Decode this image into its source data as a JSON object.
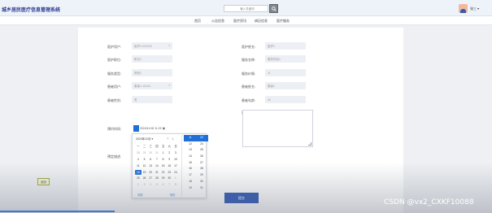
{
  "header": {
    "app_title": "城乡居民医疗信息管理系统",
    "search_placeholder": "输入关键词",
    "user_name": "张三"
  },
  "nav": {
    "items": [
      "首页",
      "公告信息",
      "医疗资讯",
      "病历信息",
      "医疗服务"
    ]
  },
  "form": {
    "labels": {
      "doctor_account": "医护用户:",
      "doctor_name": "医护姓名:",
      "doctor_title": "医护职位:",
      "service_name": "服务名称:",
      "service_type": "服务类型:",
      "service_price": "服务价格:",
      "patient_account": "患者用户:",
      "patient_name": "患者姓名:",
      "patient_gender": "患者性别:",
      "patient_age": "患者年龄:",
      "appointment_time": "预约时间:",
      "appointment_note": "预约说明:",
      "result": "预定描述:"
    },
    "values": {
      "doctor_account": "医护1-222222",
      "doctor_name": "医护1",
      "doctor_title": "职位1",
      "service_name": "服务项目1",
      "service_type": "类型1",
      "service_price": "11",
      "patient_account": "患者1-111111",
      "patient_name": "患者1",
      "patient_gender": "男",
      "patient_age": "20",
      "appointment_time": "2024/11/18 11:22"
    },
    "submit_label": "提交",
    "back_label": "返回"
  },
  "calendar": {
    "month_label": "2024年11月 ▾",
    "weekdays": [
      "一",
      "二",
      "三",
      "四",
      "五",
      "六",
      "日"
    ],
    "days": [
      {
        "d": "28",
        "dim": true
      },
      {
        "d": "29",
        "dim": true
      },
      {
        "d": "30",
        "dim": true
      },
      {
        "d": "31",
        "dim": true
      },
      {
        "d": "1"
      },
      {
        "d": "2"
      },
      {
        "d": "3"
      },
      {
        "d": "4"
      },
      {
        "d": "5"
      },
      {
        "d": "6"
      },
      {
        "d": "7"
      },
      {
        "d": "8"
      },
      {
        "d": "9"
      },
      {
        "d": "10"
      },
      {
        "d": "11"
      },
      {
        "d": "12"
      },
      {
        "d": "13"
      },
      {
        "d": "14"
      },
      {
        "d": "15"
      },
      {
        "d": "16"
      },
      {
        "d": "17"
      },
      {
        "d": "18",
        "today": true
      },
      {
        "d": "19"
      },
      {
        "d": "20"
      },
      {
        "d": "21"
      },
      {
        "d": "22"
      },
      {
        "d": "23"
      },
      {
        "d": "24"
      },
      {
        "d": "25"
      },
      {
        "d": "26"
      },
      {
        "d": "27"
      },
      {
        "d": "28"
      },
      {
        "d": "29"
      },
      {
        "d": "30"
      },
      {
        "d": "1",
        "dim": true
      },
      {
        "d": "2",
        "dim": true
      },
      {
        "d": "3",
        "dim": true
      },
      {
        "d": "4",
        "dim": true
      },
      {
        "d": "5",
        "dim": true
      },
      {
        "d": "6",
        "dim": true
      },
      {
        "d": "7",
        "dim": true
      },
      {
        "d": "8",
        "dim": true
      }
    ],
    "hours": [
      "11",
      "12",
      "13",
      "14",
      "15",
      "16",
      "17",
      "18",
      "19"
    ],
    "minutes": [
      "22",
      "24",
      "25",
      "26",
      "27",
      "28",
      "29",
      "30",
      "31"
    ],
    "clear_label": "清除",
    "today_label": "现在"
  },
  "watermark": "CSDN @vx2_CXKF10088"
}
